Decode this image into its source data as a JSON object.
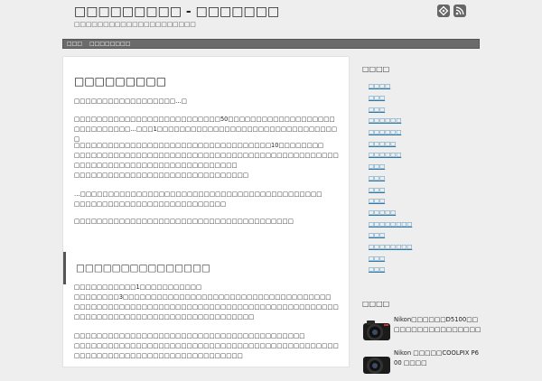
{
  "header": {
    "site_title": "□□□□□□□□□ - □□□□□□□",
    "site_description": "□□□□□□□□□□□□□□□□□□□□□",
    "icons": [
      "feedly-icon",
      "rss-icon"
    ]
  },
  "nav": {
    "items": [
      {
        "label": "□□□"
      },
      {
        "label": "□□□□□□□□"
      }
    ]
  },
  "post": {
    "title": "□□□□□□□□□",
    "paragraphs": [
      "□□□□□□□□□□□□□□□□□□…□",
      "□□□□□□□□□□□□□□□□□□□□□□□□□□50□□□□□□□□□□□□□□□□□□□□□□□□□□□□□…□□□1□□□□□□□□□□□□□□□□□□□□□□□□□□□□□□□□□",
      "□□□□□□□□□□□□□□□□□□□□□□□□□□□□□□□□□□□10□□□□□□□□\n□□□□□□□□□□□□□□□□□□□□□□□□□□□□□□□□□□□□□□□□□□□□□□□□□□□□□□□□□□□□□□□□□□□□□□□□□□□□\n□□□□□□□□□□□□□□□□□□□□□□□□□□□□□□□",
      "…□□□□□□□□□□□□□□□□□□□□□□□□□□□□□□□□□□□□□□□□□□□\n□□□□□□□□□□□□□□□□□□□□□□□□□□□",
      "□□□□□□□□□□□□□□□□□□□□□□□□□□□□□□□□□□□□□□□"
    ],
    "sub_heading": "□□□□□□□□□□□□□□□",
    "paragraphs2": [
      "□□□□□□□□□□□1□□□□□□□□□□□\n□□□□□□□□3□□□□□□□□□□□□□□□□□□□□□□□□□□□□□□□□□□□□□\n□□□□□□□□□□□□□□□□□□□□□□□□□□□□□□□□□□□□□□□□□□□□□□□□□□□□□□□□□□□□□□□□□□□□□□□□□□□□□□□",
      "□□□□□□□□□□□□□□□□□□□□□□□□□□□□□□□□□□□□□□□□□\n□□□□□□□□□□□□□□□□□□□□□□□□□□□□□□□□□□□□□□□□□□□□□□□□□□□□□□□□□□□□□□□□□□□□□□□□□□□□□"
    ]
  },
  "sidebar": {
    "categories_heading": "□□□□",
    "categories": [
      "□□□□",
      "□□□",
      "□□□",
      "□□□□□□",
      "□□□□□□",
      "□□□□□",
      "□□□□□□",
      "□□□",
      "□□□",
      "□□□",
      "□□□",
      "□□□□□",
      "□□□□□□□□",
      "□□□",
      "□□□□□□□□",
      "□□□",
      "□□□"
    ],
    "products_heading": "□□□□",
    "products": [
      {
        "title": "Nikon□□□□□□D5100□□□□□□□□□□□□□□□□□"
      },
      {
        "title": "Nikon □□□□□COOLPIX P600 □□□□"
      }
    ]
  },
  "colors": {
    "link": "#2d7aa8",
    "nav_bg": "#6b6b6b",
    "page_bg": "#eeeeee",
    "content_bg": "#ffffff"
  }
}
